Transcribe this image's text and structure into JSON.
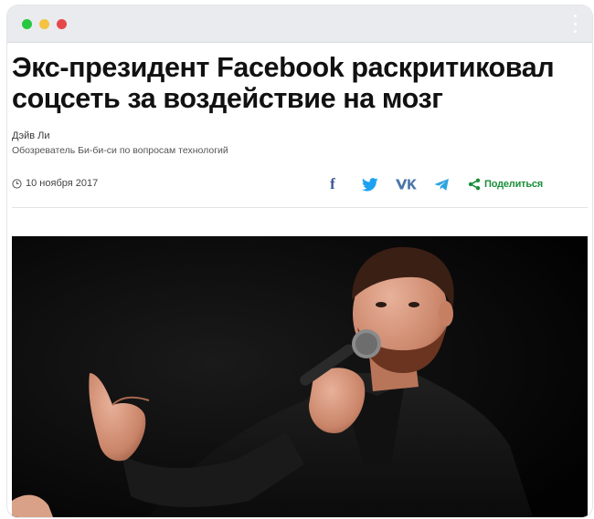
{
  "article": {
    "headline": "Экс-президент Facebook раскритиковал соцсеть за воздействие на мозг",
    "author_name": "Дэйв Ли",
    "author_role": "Обозреватель Би-би-си по вопросам технологий",
    "date": "10 ноября 2017"
  },
  "share": {
    "facebook_glyph": "f",
    "share_label": "Поделиться"
  },
  "icons": {
    "facebook": "facebook-icon",
    "twitter": "twitter-icon",
    "vk": "vk-icon",
    "telegram": "telegram-icon",
    "share": "share-icon",
    "clock": "clock-icon"
  },
  "colors": {
    "titlebar": "#e9ebee",
    "dot_green": "#27c840",
    "dot_yellow": "#f5c242",
    "dot_red": "#e6484a",
    "facebook_blue": "#3b5998",
    "twitter_blue": "#1da1f2",
    "vk_blue": "#4a76a8",
    "telegram_blue": "#2ca5e0",
    "share_green": "#1a8f3a"
  }
}
